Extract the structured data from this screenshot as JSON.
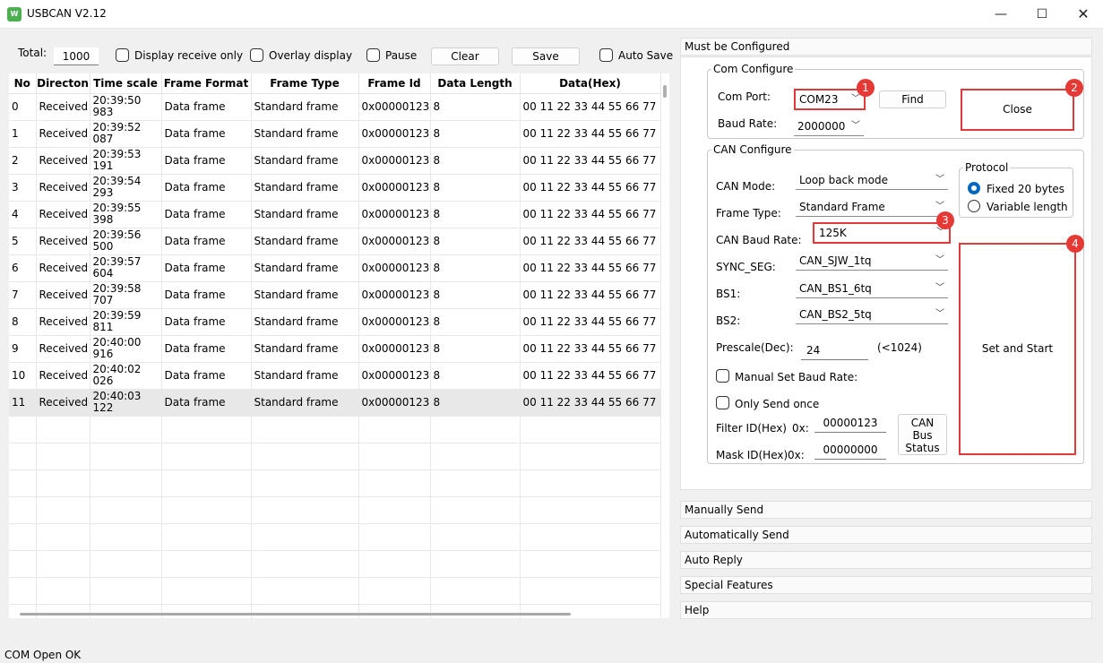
{
  "window": {
    "title": "USBCAN V2.12",
    "icon_text": "W",
    "minimize_glyph": "—",
    "maximize_glyph": "☐",
    "close_glyph": "✕"
  },
  "toolbar": {
    "total_label": "Total:",
    "total_value": "1000",
    "display_receive_only": "Display receive only",
    "overlay_display": "Overlay display",
    "pause": "Pause",
    "clear": "Clear",
    "save": "Save",
    "auto_save": "Auto Save"
  },
  "table": {
    "columns": [
      "No",
      "Directon",
      "Time scale",
      "Frame Format",
      "Frame Type",
      "Frame Id",
      "Data Length",
      "Data(Hex)"
    ],
    "rows": [
      {
        "no": "0",
        "dir": "Received",
        "t1": "20:39:50",
        "t2": "983",
        "fmt": "Data frame",
        "type": "Standard frame",
        "id": "0x00000123",
        "len": "8",
        "data": "00 11 22 33 44 55 66 77"
      },
      {
        "no": "1",
        "dir": "Received",
        "t1": "20:39:52",
        "t2": "087",
        "fmt": "Data frame",
        "type": "Standard frame",
        "id": "0x00000123",
        "len": "8",
        "data": "00 11 22 33 44 55 66 77"
      },
      {
        "no": "2",
        "dir": "Received",
        "t1": "20:39:53",
        "t2": "191",
        "fmt": "Data frame",
        "type": "Standard frame",
        "id": "0x00000123",
        "len": "8",
        "data": "00 11 22 33 44 55 66 77"
      },
      {
        "no": "3",
        "dir": "Received",
        "t1": "20:39:54",
        "t2": "293",
        "fmt": "Data frame",
        "type": "Standard frame",
        "id": "0x00000123",
        "len": "8",
        "data": "00 11 22 33 44 55 66 77"
      },
      {
        "no": "4",
        "dir": "Received",
        "t1": "20:39:55",
        "t2": "398",
        "fmt": "Data frame",
        "type": "Standard frame",
        "id": "0x00000123",
        "len": "8",
        "data": "00 11 22 33 44 55 66 77"
      },
      {
        "no": "5",
        "dir": "Received",
        "t1": "20:39:56",
        "t2": "500",
        "fmt": "Data frame",
        "type": "Standard frame",
        "id": "0x00000123",
        "len": "8",
        "data": "00 11 22 33 44 55 66 77"
      },
      {
        "no": "6",
        "dir": "Received",
        "t1": "20:39:57",
        "t2": "604",
        "fmt": "Data frame",
        "type": "Standard frame",
        "id": "0x00000123",
        "len": "8",
        "data": "00 11 22 33 44 55 66 77"
      },
      {
        "no": "7",
        "dir": "Received",
        "t1": "20:39:58",
        "t2": "707",
        "fmt": "Data frame",
        "type": "Standard frame",
        "id": "0x00000123",
        "len": "8",
        "data": "00 11 22 33 44 55 66 77"
      },
      {
        "no": "8",
        "dir": "Received",
        "t1": "20:39:59",
        "t2": "811",
        "fmt": "Data frame",
        "type": "Standard frame",
        "id": "0x00000123",
        "len": "8",
        "data": "00 11 22 33 44 55 66 77"
      },
      {
        "no": "9",
        "dir": "Received",
        "t1": "20:40:00",
        "t2": "916",
        "fmt": "Data frame",
        "type": "Standard frame",
        "id": "0x00000123",
        "len": "8",
        "data": "00 11 22 33 44 55 66 77"
      },
      {
        "no": "10",
        "dir": "Received",
        "t1": "20:40:02",
        "t2": "026",
        "fmt": "Data frame",
        "type": "Standard frame",
        "id": "0x00000123",
        "len": "8",
        "data": "00 11 22 33 44 55 66 77"
      },
      {
        "no": "11",
        "dir": "Received",
        "t1": "20:40:03",
        "t2": "122",
        "fmt": "Data frame",
        "type": "Standard frame",
        "id": "0x00000123",
        "len": "8",
        "data": "00 11 22 33 44 55 66 77"
      }
    ],
    "selected_row": 11,
    "empty_rows": 8
  },
  "must_config": {
    "header": "Must be Configured",
    "com": {
      "legend": "Com Configure",
      "port_label": "Com Port:",
      "port_value": "COM23",
      "find": "Find",
      "baud_label": "Baud Rate:",
      "baud_value": "2000000",
      "close": "Close"
    },
    "can": {
      "legend": "CAN Configure",
      "mode_label": "CAN Mode:",
      "mode_value": "Loop back mode",
      "frame_type_label": "Frame Type:",
      "frame_type_value": "Standard Frame",
      "baud_label": "CAN Baud Rate:",
      "baud_value": "125K",
      "sync_label": "SYNC_SEG:",
      "sync_value": "CAN_SJW_1tq",
      "bs1_label": "BS1:",
      "bs1_value": "CAN_BS1_6tq",
      "bs2_label": "BS2:",
      "bs2_value": "CAN_BS2_5tq",
      "prescale_label": "Prescale(Dec):",
      "prescale_value": "24",
      "prescale_hint": "(<1024)",
      "manual_baud": "Manual Set Baud Rate:",
      "only_send_once": "Only Send once",
      "filter_label": "Filter ID(Hex)",
      "filter_prefix": "0x:",
      "filter_value": "00000123",
      "mask_label": "Mask ID(Hex)",
      "mask_prefix": "0x:",
      "mask_value": "00000000",
      "bus_status_l1": "CAN",
      "bus_status_l2": "Bus",
      "bus_status_l3": "Status",
      "set_and_start": "Set and Start"
    },
    "protocol": {
      "legend": "Protocol",
      "fixed": "Fixed 20 bytes",
      "variable": "Variable length",
      "selected": "fixed"
    },
    "badges": [
      "1",
      "2",
      "3",
      "4"
    ]
  },
  "sections": [
    "Manually Send",
    "Automatically Send",
    "Auto Reply",
    "Special Features",
    "Help"
  ],
  "status": "COM Open OK",
  "colors": {
    "highlight_red": "#e03a3a",
    "badge_red": "#e53935",
    "radio_blue": "#0067c0"
  }
}
